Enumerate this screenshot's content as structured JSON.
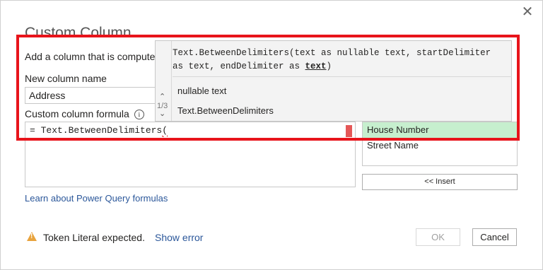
{
  "dialog": {
    "title": "Custom Column",
    "subtitle": "Add a column that is computed from the other columns.",
    "close_glyph": "✕"
  },
  "new_column": {
    "label": "New column name",
    "value": "Address"
  },
  "formula": {
    "label": "Custom column formula",
    "info_glyph": "i",
    "text": "= Text.BetweenDelimiters",
    "paren": "("
  },
  "available_columns": {
    "items": [
      "House Number",
      "Street Name"
    ],
    "selected": "House Number"
  },
  "insert_button": "<< Insert",
  "learn_link": "Learn about Power Query formulas",
  "status": {
    "message": "Token Literal expected.",
    "show_error": "Show error",
    "icon": "warning-icon"
  },
  "buttons": {
    "ok": "OK",
    "cancel": "Cancel"
  },
  "intellisense": {
    "signature_before": "Text.BetweenDelimiters(text as nullable text, startDelimiter as text, endDelimiter as ",
    "signature_current": "text",
    "signature_after": ")",
    "param_type": "nullable text",
    "function_name": "Text.BetweenDelimiters",
    "counter": "1/3",
    "up_glyph": "⌃",
    "down_glyph": "⌄"
  },
  "colors": {
    "highlight": "#e8141b",
    "selected_column": "#c6efce",
    "link": "#2b579a"
  }
}
